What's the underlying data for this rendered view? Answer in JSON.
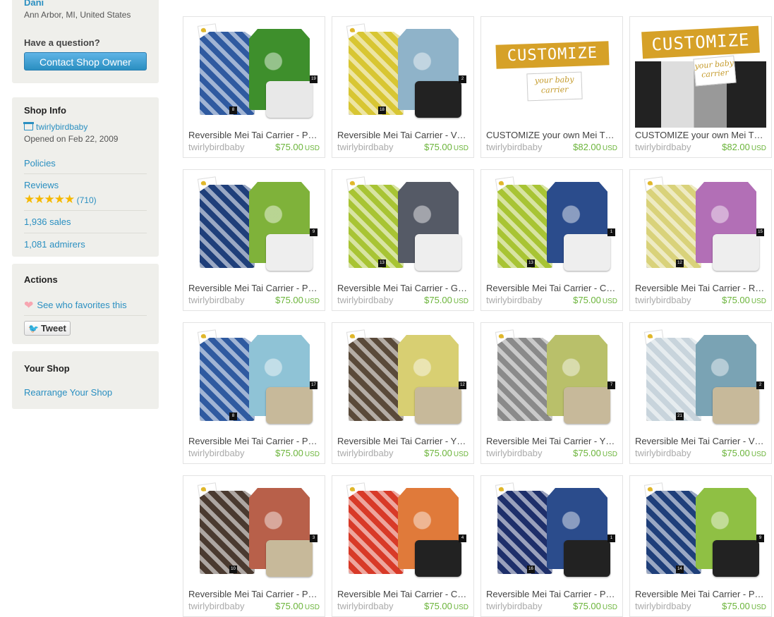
{
  "sidebar": {
    "owner": {
      "name": "Dani",
      "location": "Ann Arbor, MI, United States"
    },
    "question": "Have a question?",
    "contact_label": "Contact Shop Owner",
    "shop_info": {
      "title": "Shop Info",
      "shop_name": "twirlybirdbaby",
      "opened": "Opened on Feb 22, 2009",
      "policies": "Policies",
      "reviews": "Reviews",
      "review_count": "(710)",
      "rating": 5,
      "sales": "1,936 sales",
      "admirers": "1,081 admirers"
    },
    "actions": {
      "title": "Actions",
      "favorites": "See who favorites this",
      "tweet": "Tweet"
    },
    "your_shop": {
      "title": "Your Shop",
      "rearrange": "Rearrange Your Shop"
    }
  },
  "listings": [
    {
      "title": "Reversible Mei Tai Carrier - P…",
      "shop": "twirlybirdbaby",
      "price": "$75.00",
      "currency": "USD",
      "badges": [
        "8",
        "19"
      ],
      "colors": [
        "#2f5aa0",
        "#3e8f2c",
        "#e8e8e8"
      ]
    },
    {
      "title": "Reversible Mei Tai Carrier - V…",
      "shop": "twirlybirdbaby",
      "price": "$75.00",
      "currency": "USD",
      "badges": [
        "18",
        "2"
      ],
      "colors": [
        "#d8c633",
        "#8fb3c9",
        "#222222"
      ]
    },
    {
      "title": "CUSTOMIZE your own Mei T…",
      "shop": "twirlybirdbaby",
      "price": "$82.00",
      "currency": "USD",
      "customize": "CUSTOMIZE",
      "tagline": "your baby carrier"
    },
    {
      "title": "CUSTOMIZE your own Mei T…",
      "shop": "twirlybirdbaby",
      "price": "$82.00",
      "currency": "USD",
      "customize": "CUSTOMIZE",
      "tagline": "your baby carrier"
    },
    {
      "title": "Reversible Mei Tai Carrier - P…",
      "shop": "twirlybirdbaby",
      "price": "$75.00",
      "currency": "USD",
      "badges": [
        "",
        "9"
      ],
      "colors": [
        "#1f3f7a",
        "#7fb23a",
        "#eeeeee"
      ]
    },
    {
      "title": "Reversible Mei Tai Carrier - G…",
      "shop": "twirlybirdbaby",
      "price": "$75.00",
      "currency": "USD",
      "badges": [
        "13",
        ""
      ],
      "colors": [
        "#a8c434",
        "#555a66",
        "#eeeeee"
      ]
    },
    {
      "title": "Reversible Mei Tai Carrier - C…",
      "shop": "twirlybirdbaby",
      "price": "$75.00",
      "currency": "USD",
      "badges": [
        "13",
        "1"
      ],
      "colors": [
        "#a8c434",
        "#2b4c8c",
        "#eeeeee"
      ]
    },
    {
      "title": "Reversible Mei Tai Carrier - R…",
      "shop": "twirlybirdbaby",
      "price": "$75.00",
      "currency": "USD",
      "badges": [
        "12",
        "15"
      ],
      "colors": [
        "#d9d27a",
        "#b26fb6",
        "#eeeeee"
      ]
    },
    {
      "title": "Reversible Mei Tai Carrier - P…",
      "shop": "twirlybirdbaby",
      "price": "$75.00",
      "currency": "USD",
      "badges": [
        "8",
        "17"
      ],
      "colors": [
        "#2f5aa0",
        "#8fc3d6",
        "#c7b99a"
      ]
    },
    {
      "title": "Reversible Mei Tai Carrier - Y…",
      "shop": "twirlybirdbaby",
      "price": "$75.00",
      "currency": "USD",
      "badges": [
        "",
        "12"
      ],
      "colors": [
        "#5a4a3a",
        "#d8cf72",
        "#c7b99a"
      ]
    },
    {
      "title": "Reversible Mei Tai Carrier - Y…",
      "shop": "twirlybirdbaby",
      "price": "$75.00",
      "currency": "USD",
      "badges": [
        "",
        "7"
      ],
      "colors": [
        "#8a8a8a",
        "#b9c06a",
        "#c7b99a"
      ]
    },
    {
      "title": "Reversible Mei Tai Carrier - V…",
      "shop": "twirlybirdbaby",
      "price": "$75.00",
      "currency": "USD",
      "badges": [
        "21",
        "2"
      ],
      "colors": [
        "#c8d4dc",
        "#7aa3b4",
        "#c7b99a"
      ]
    },
    {
      "title": "Reversible Mei Tai Carrier - P…",
      "shop": "twirlybirdbaby",
      "price": "$75.00",
      "currency": "USD",
      "badges": [
        "10",
        "3"
      ],
      "colors": [
        "#4a3a30",
        "#b8604a",
        "#c7b99a"
      ]
    },
    {
      "title": "Reversible Mei Tai Carrier - C…",
      "shop": "twirlybirdbaby",
      "price": "$75.00",
      "currency": "USD",
      "badges": [
        "",
        "4"
      ],
      "colors": [
        "#d83a28",
        "#e07a3a",
        "#222222"
      ]
    },
    {
      "title": "Reversible Mei Tai Carrier - P…",
      "shop": "twirlybirdbaby",
      "price": "$75.00",
      "currency": "USD",
      "badges": [
        "16",
        "1"
      ],
      "colors": [
        "#1e2f6a",
        "#2b4c8c",
        "#222222"
      ]
    },
    {
      "title": "Reversible Mei Tai Carrier - P…",
      "shop": "twirlybirdbaby",
      "price": "$75.00",
      "currency": "USD",
      "badges": [
        "14",
        "9"
      ],
      "colors": [
        "#1f3f7a",
        "#8fc044",
        "#222222"
      ]
    }
  ]
}
